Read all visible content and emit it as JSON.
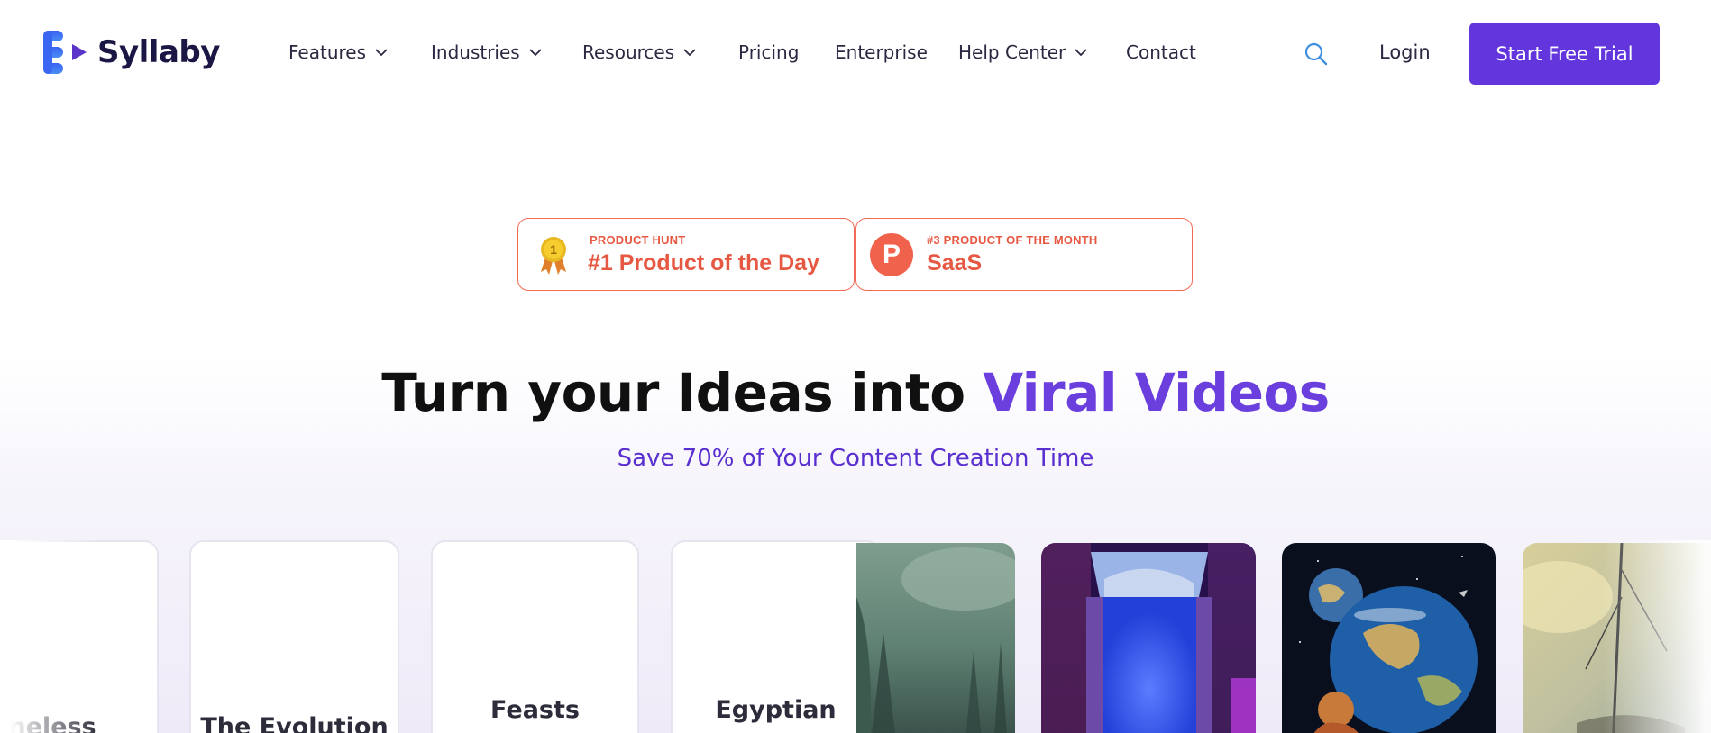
{
  "brand": {
    "name": "Syllaby",
    "color_primary": "#6236dc",
    "color_logo_blue": "#3b6cf0"
  },
  "nav": {
    "items": [
      {
        "label": "Features",
        "has_dropdown": true
      },
      {
        "label": "Industries",
        "has_dropdown": true
      },
      {
        "label": "Resources",
        "has_dropdown": true
      },
      {
        "label": "Pricing",
        "has_dropdown": false
      },
      {
        "label": "Enterprise",
        "has_dropdown": false
      },
      {
        "label": "Help Center",
        "has_dropdown": true
      },
      {
        "label": "Contact",
        "has_dropdown": false
      }
    ],
    "search_icon": "search-icon",
    "login_label": "Login",
    "cta_label": "Start Free Trial"
  },
  "badges": [
    {
      "small": "PRODUCT HUNT",
      "big": "#1 Product of the Day",
      "icon": "medal-icon",
      "medal_number": "1"
    },
    {
      "small": "#3 PRODUCT OF THE MONTH",
      "big": "SaaS",
      "icon": "product-hunt-icon",
      "logo_letter": "P"
    }
  ],
  "hero": {
    "headline_main": "Turn your Ideas into ",
    "headline_accent": "Viral Videos",
    "subheadline": "Save 70% of Your Content Creation Time",
    "accent_color": "#6a3fde"
  },
  "carousel": {
    "text_cards": [
      {
        "title": "neless"
      },
      {
        "title": "The Evolution"
      },
      {
        "title": "Feasts"
      },
      {
        "title": "Egyptian"
      }
    ],
    "image_cards": [
      {
        "subject": "misty-forest"
      },
      {
        "subject": "glowing-portal-doorway"
      },
      {
        "subject": "child-viewing-planets"
      },
      {
        "subject": "sailing-ship-clouds"
      }
    ]
  }
}
